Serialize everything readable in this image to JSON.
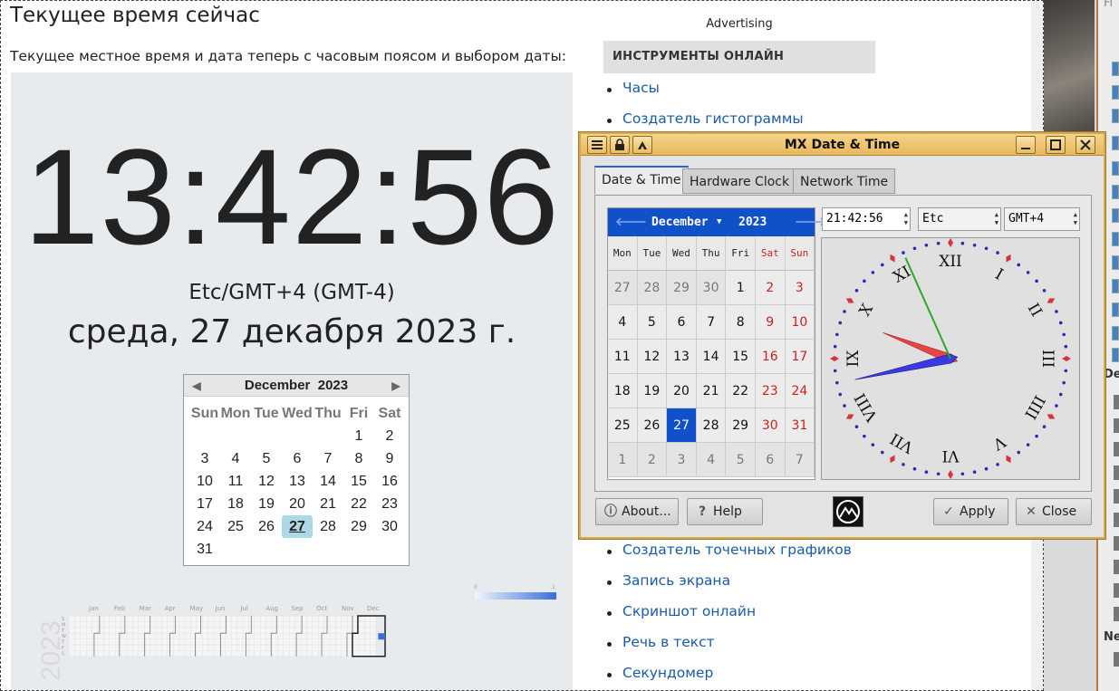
{
  "page": {
    "heading": "Текущее время сейчас",
    "subheading": "Текущее местное время и дата теперь с часовым поясом и выбором даты:",
    "clock": "13:42:56",
    "timezone": "Etc/GMT+4 (GMT-4)",
    "date_long": "среда, 27 декабря 2023 г."
  },
  "web_calendar": {
    "month": "December",
    "year": "2023",
    "weekdays": [
      "Sun",
      "Mon",
      "Tue",
      "Wed",
      "Thu",
      "Fri",
      "Sat"
    ],
    "first_weekday_index": 5,
    "days_in_month": 31,
    "selected_day": 27
  },
  "heatmap": {
    "year": "2023",
    "months": [
      "Jan",
      "Feb",
      "Mar",
      "Apr",
      "May",
      "Jun",
      "Jul",
      "Aug",
      "Sep",
      "Oct",
      "Nov",
      "Dec"
    ],
    "day_labels": [
      "S",
      "M",
      "T",
      "W",
      "T",
      "F",
      "S"
    ],
    "legend_min": "0",
    "legend_max": "1",
    "highlight_color": "#3a6fd8"
  },
  "sidebar": {
    "advertising": "Advertising",
    "box_title": "ИНСТРУМЕНТЫ ОНЛАЙН",
    "links_top": [
      "Часы",
      "Создатель гистограммы"
    ],
    "links_bottom": [
      "Создатель точечных графиков",
      "Запись экрана",
      "Скриншот онлайн",
      "Речь в текст",
      "Секундомер"
    ]
  },
  "background": {
    "label_fi": "Fi",
    "label_de": "De",
    "label_ne": "Ne"
  },
  "mx": {
    "title": "MX Date & Time",
    "tabs": [
      "Date & Time",
      "Hardware Clock",
      "Network Time"
    ],
    "active_tab": 0,
    "calendar": {
      "month": "December",
      "year": "2023",
      "weekdays": [
        "Mon",
        "Tue",
        "Wed",
        "Thu",
        "Fri",
        "Sat",
        "Sun"
      ],
      "weeks": [
        [
          27,
          28,
          29,
          30,
          1,
          2,
          3
        ],
        [
          4,
          5,
          6,
          7,
          8,
          9,
          10
        ],
        [
          11,
          12,
          13,
          14,
          15,
          16,
          17
        ],
        [
          18,
          19,
          20,
          21,
          22,
          23,
          24
        ],
        [
          25,
          26,
          27,
          28,
          29,
          30,
          31
        ],
        [
          1,
          2,
          3,
          4,
          5,
          6,
          7
        ]
      ],
      "selected": 27,
      "weekend_color": "#cc1f1f",
      "header_color": "#1050c8"
    },
    "time_value": "21:42:56",
    "region": "Etc",
    "zone": "GMT+4",
    "analog": {
      "numerals": [
        "XII",
        "I",
        "II",
        "III",
        "IIII",
        "V",
        "VI",
        "VII",
        "VIII",
        "IX",
        "X",
        "XI"
      ],
      "hours": 21,
      "minutes": 42,
      "seconds": 56
    },
    "buttons": {
      "about": "About...",
      "help": "Help",
      "apply": "Apply",
      "close": "Close"
    }
  }
}
